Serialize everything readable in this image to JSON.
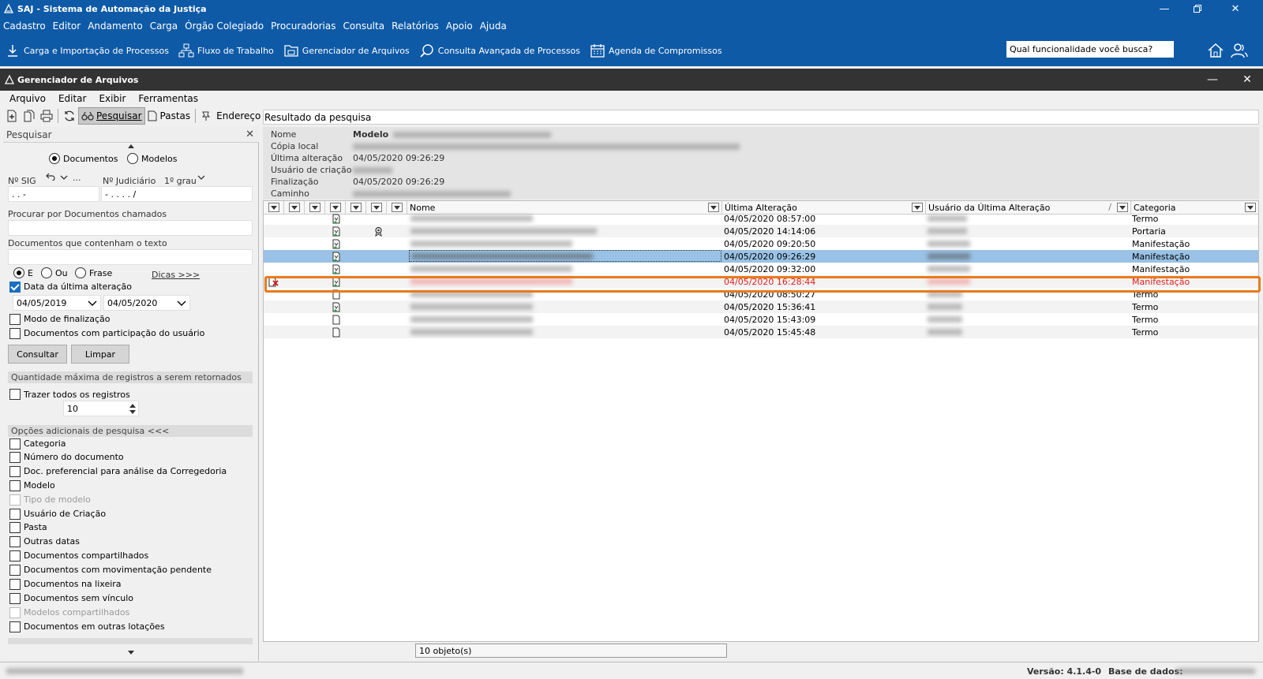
{
  "app": {
    "title": "SAJ - Sistema de Automação da Justiça"
  },
  "main_menu": [
    "Cadastro",
    "Editor",
    "Andamento",
    "Carga",
    "Órgão Colegiado",
    "Procuradorias",
    "Consulta",
    "Relatórios",
    "Apoio",
    "Ajuda"
  ],
  "main_toolbar": {
    "items": [
      "Carga e Importação de Processos",
      "Fluxo de Trabalho",
      "Gerenciador de Arquivos",
      "Consulta Avançada de Processos",
      "Agenda de Compromissos"
    ],
    "search_value": "Qual funcionalidade você busca?"
  },
  "child_window": {
    "title": "Gerenciador de Arquivos",
    "menu": [
      "Arquivo",
      "Editar",
      "Exibir",
      "Ferramentas"
    ],
    "toolbar": {
      "search": "Pesquisar",
      "folders": "Pastas",
      "address_label": "Endereço",
      "address_value": "Resultado da pesquisa"
    }
  },
  "left_panel": {
    "header": "Pesquisar",
    "type_documents": "Documentos",
    "type_models": "Modelos",
    "sig_label": "Nº SIG",
    "sig_dots": "...",
    "judicial_label": "Nº Judiciário",
    "degree": "1º grau",
    "sig_mask": ".   .     -",
    "judicial_mask": "-   .    .   .   .   /",
    "search_called_label": "Procurar por Documentos chamados",
    "contains_text_label": "Documentos que contenham o texto",
    "mode_and": "E",
    "mode_or": "Ou",
    "mode_phrase": "Frase",
    "tips": "Dicas >>>",
    "last_change_label": "Data da última alteração",
    "date_from": "04/05/2019",
    "date_to": "04/05/2020",
    "finalization_label": "Modo de finalização",
    "participation_label": "Documentos com participação do usuário",
    "consult_button": "Consultar",
    "clear_button": "Limpar",
    "max_records_section": "Quantidade máxima de registros a serem retornados",
    "bring_all_label": "Trazer todos os registros",
    "max_records_value": "10",
    "additional_section": "Opções adicionais de pesquisa <<<",
    "options": [
      {
        "label": "Categoria",
        "disabled": false
      },
      {
        "label": "Número do documento",
        "disabled": false
      },
      {
        "label": "Doc. preferencial para análise da Corregedoria",
        "disabled": false
      },
      {
        "label": "Modelo",
        "disabled": false
      },
      {
        "label": "Tipo de modelo",
        "disabled": true
      },
      {
        "label": "Usuário de Criação",
        "disabled": false
      },
      {
        "label": "Pasta",
        "disabled": false
      },
      {
        "label": "Outras datas",
        "disabled": false
      },
      {
        "label": "Documentos compartilhados",
        "disabled": false
      },
      {
        "label": "Documentos com movimentação pendente",
        "disabled": false
      },
      {
        "label": "Documentos na lixeira",
        "disabled": false
      },
      {
        "label": "Documentos sem vínculo",
        "disabled": false
      },
      {
        "label": "Modelos compartilhados",
        "disabled": true
      },
      {
        "label": "Documentos em outras lotações",
        "disabled": false
      }
    ]
  },
  "info": {
    "labels": [
      "Nome",
      "Cópia local",
      "Última alteração",
      "Usuário de criação",
      "Finalização",
      "Caminho"
    ],
    "name_key": "Modelo",
    "last_change": "04/05/2020 09:26:29",
    "finalization": "04/05/2020 09:26:29"
  },
  "grid": {
    "columns": {
      "name": "Nome",
      "last_change": "Última Alteração",
      "last_user": "Usuário da Última Alteração",
      "category": "Categoria"
    },
    "rows": [
      {
        "date": "04/05/2020 08:57:00",
        "category": "Termo",
        "state": "normal"
      },
      {
        "date": "04/05/2020 14:14:06",
        "category": "Portaria",
        "state": "normal"
      },
      {
        "date": "04/05/2020 09:20:50",
        "category": "Manifestação",
        "state": "normal"
      },
      {
        "date": "04/05/2020 09:26:29",
        "category": "Manifestação",
        "state": "selected"
      },
      {
        "date": "04/05/2020 09:32:00",
        "category": "Manifestação",
        "state": "normal"
      },
      {
        "date": "04/05/2020 16:28:44",
        "category": "Manifestação",
        "state": "error"
      },
      {
        "date": "04/05/2020 08:50:27",
        "category": "Termo",
        "state": "normal"
      },
      {
        "date": "04/05/2020 15:36:41",
        "category": "Termo",
        "state": "normal"
      },
      {
        "date": "04/05/2020 15:43:09",
        "category": "Termo",
        "state": "normal"
      },
      {
        "date": "04/05/2020 15:45:48",
        "category": "Termo",
        "state": "normal"
      }
    ],
    "count": "10 objeto(s)"
  },
  "status": {
    "version": "Versão: 4.1.4-0",
    "database": "Base de dados:"
  },
  "colors": {
    "brand_blue": "#0e5aa7",
    "dark_bar": "#333333",
    "selection": "#99c2e6",
    "error_red": "#e02020",
    "highlight_orange": "#ea7a1b"
  }
}
